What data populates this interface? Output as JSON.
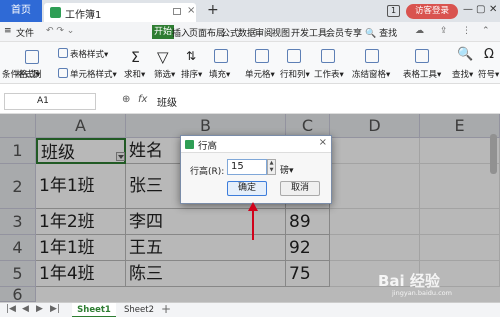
{
  "titlebar": {
    "home_tab": "首页",
    "doc_tab": "工作簿1",
    "close_glyph": "×",
    "new_tab_glyph": "+",
    "window_count": "1",
    "login_button": "访客登录",
    "minimize": "—",
    "maximize": "▢",
    "close": "✕"
  },
  "menu": {
    "file": "文件",
    "items": [
      "开始",
      "插入",
      "页面布局",
      "公式",
      "数据",
      "审阅",
      "视图",
      "开发工具",
      "会员专享"
    ],
    "search": "查找"
  },
  "ribbon": {
    "labels": [
      "格式刷",
      "条件格式",
      "表格样式",
      "单元格样式",
      "求和",
      "筛选",
      "排序",
      "填充",
      "单元格",
      "行和列",
      "工作表",
      "冻结窗格",
      "表格工具",
      "查找",
      "符号"
    ]
  },
  "formula_bar": {
    "cell_ref": "A1",
    "fx": "fx",
    "value": "班级"
  },
  "grid": {
    "columns": [
      "A",
      "B",
      "C",
      "D",
      "E"
    ],
    "rows": [
      "1",
      "2",
      "3",
      "4",
      "5",
      "6"
    ],
    "cells": [
      [
        "班级",
        "姓名",
        ""
      ],
      [
        "1年1班",
        "张三",
        ""
      ],
      [
        "1年2班",
        "李四",
        "89"
      ],
      [
        "1年1班",
        "王五",
        "92"
      ],
      [
        "1年4班",
        "陈三",
        "75"
      ]
    ]
  },
  "dialog": {
    "title": "行高",
    "label": "行高(R):",
    "value": "15",
    "unit": "磅",
    "ok": "确定",
    "cancel": "取消",
    "close_glyph": "×"
  },
  "sheets": {
    "tabs": [
      "Sheet1",
      "Sheet2"
    ],
    "add": "+",
    "nav": [
      "|◀",
      "◀",
      "▶",
      "▶|"
    ]
  },
  "watermark": {
    "text": "Bai 经验",
    "sub": "jingyan.baidu.com"
  },
  "colors": {
    "accent_green": "#2e7d32",
    "title_blue": "#2f6ad6",
    "login_red": "#d9534f",
    "arrow_red": "#d0021b"
  }
}
